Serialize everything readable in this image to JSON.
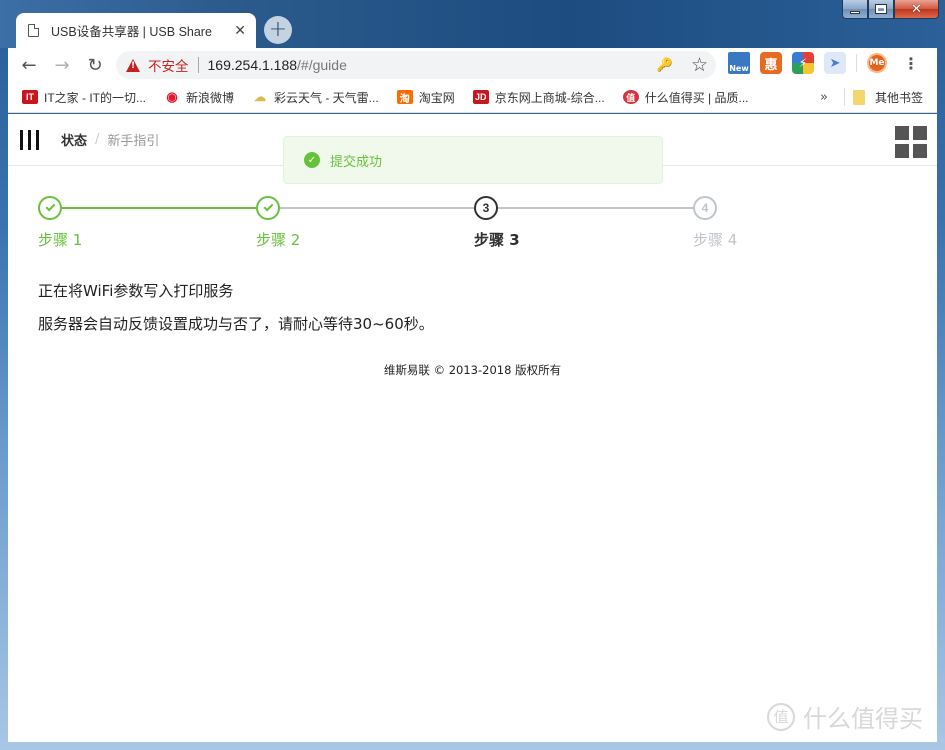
{
  "window": {
    "minimize_label": "minimize",
    "maximize_label": "maximize",
    "close_label": "close"
  },
  "browser": {
    "tab": {
      "title": "USB设备共享器 | USB Share",
      "close_glyph": "✕"
    },
    "new_tab_glyph": "+",
    "nav": {
      "back": "←",
      "forward": "→",
      "reload": "↻"
    },
    "omnibox": {
      "security_label": "不安全",
      "url_host": "169.254.1.188",
      "url_path": "/#/guide"
    },
    "omnibox_icons": {
      "key": "🔑",
      "star": "☆"
    },
    "extensions": [
      {
        "name": "new-extension",
        "text": "New"
      },
      {
        "name": "hui-extension",
        "text": "惠"
      },
      {
        "name": "bolt-extension",
        "text": "⚡"
      },
      {
        "name": "bird-extension",
        "text": "➤"
      },
      {
        "name": "me-extension",
        "text": "Me"
      }
    ],
    "menu_glyph": "⋮",
    "bookmarks": [
      {
        "icon": "IT",
        "label": "IT之家 - IT的一切..."
      },
      {
        "icon": "◉",
        "label": "新浪微博"
      },
      {
        "icon": "☁",
        "label": "彩云天气 - 天气雷..."
      },
      {
        "icon": "淘",
        "label": "淘宝网"
      },
      {
        "icon": "JD",
        "label": "京东网上商城-综合..."
      },
      {
        "icon": "值",
        "label": "什么值得买 | 品质..."
      }
    ],
    "bookmarks_more": "»",
    "other_bookmarks": "其他书签"
  },
  "app": {
    "breadcrumb": {
      "root": "状态",
      "separator": "/",
      "current": "新手指引"
    },
    "toast": {
      "icon": "✓",
      "message": "提交成功",
      "type": "success"
    },
    "steps": [
      {
        "label": "步骤 1",
        "number": "1",
        "status": "done"
      },
      {
        "label": "步骤 2",
        "number": "2",
        "status": "done"
      },
      {
        "label": "步骤 3",
        "number": "3",
        "status": "active"
      },
      {
        "label": "步骤 4",
        "number": "4",
        "status": "wait"
      }
    ],
    "messages": [
      "正在将WiFi参数写入打印服务",
      "服务器会自动反馈设置成功与否了，请耐心等待30~60秒。"
    ],
    "footer": "维斯易联 © 2013-2018 版权所有"
  },
  "watermark": {
    "icon": "值",
    "text": "什么值得买"
  },
  "colors": {
    "success": "#67c23a",
    "active": "#303133",
    "wait": "#c0c4cc",
    "insecure": "#c5221f"
  }
}
